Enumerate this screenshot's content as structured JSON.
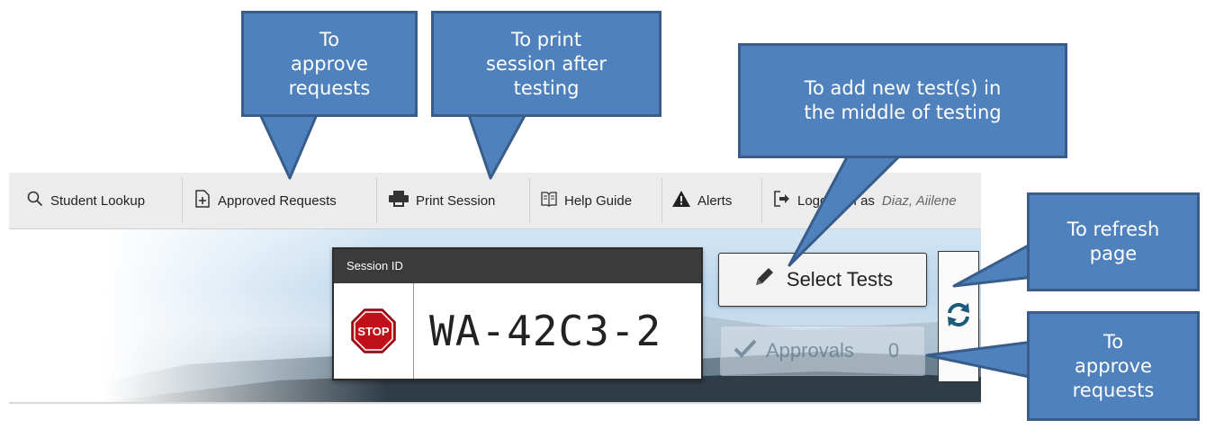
{
  "toolbar": {
    "student_lookup": "Student Lookup",
    "approved_requests": "Approved Requests",
    "print_session": "Print Session",
    "help_guide": "Help Guide",
    "alerts": "Alerts",
    "logged_in_as": "Logged in as",
    "user_name": "Diaz, Aiilene"
  },
  "session": {
    "header": "Session ID",
    "id": "WA-42C3-2",
    "stop_label": "STOP"
  },
  "buttons": {
    "select_tests": "Select Tests",
    "approvals": "Approvals",
    "approvals_count": "0"
  },
  "callouts": {
    "approve_top": "To\napprove\nrequests",
    "print": "To print\nsession after\ntesting",
    "add_tests": "To add new test(s) in\nthe middle of testing",
    "refresh": "To refresh\npage",
    "approve_right": "To\napprove\nrequests"
  },
  "colors": {
    "callout_fill": "#4f81bd",
    "callout_border": "#385d8a",
    "stop_red": "#c0111a"
  },
  "icons": {
    "search": "search-icon",
    "approved": "document-plus-icon",
    "print": "printer-icon",
    "help": "book-icon",
    "alerts": "warning-triangle-icon",
    "logout": "logout-icon",
    "pencil": "pencil-icon",
    "check": "checkmark-icon",
    "refresh": "refresh-icon"
  }
}
